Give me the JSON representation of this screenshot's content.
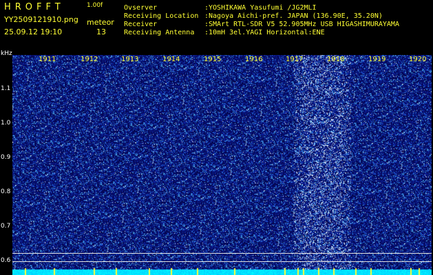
{
  "header": {
    "logo": "HROFFT",
    "version": "1.00f",
    "filename": "YY2509121910.png",
    "mode": "meteor",
    "datetime": "25.09.12 19:10",
    "count": "13"
  },
  "info": [
    {
      "label": "Ovserver",
      "value": ":YOSHIKAWA Yasufumi /JG2MLI"
    },
    {
      "label": "Receiving Location",
      "value": ":Nagoya Aichi-pref. JAPAN (136.90E, 35.20N)"
    },
    {
      "label": "Receiver",
      "value": ":SMArt RTL-SDR V5 52.905MHz USB HIGASHIMURAYAMA"
    },
    {
      "label": "Receiving Antenna",
      "value": ":10mH 3el.YAGI Horizontal:ENE"
    }
  ],
  "axis": {
    "y_unit": "kHz",
    "y_ticks": [
      "1.1",
      "1.0",
      "0.9",
      "0.8",
      "0.7",
      "0.6"
    ],
    "x_ticks": [
      "1911",
      "1912",
      "1913",
      "1914",
      "1915",
      "1916",
      "1917",
      "1918",
      "1919",
      "1920"
    ]
  },
  "colors": {
    "background": "#000000",
    "label_text": "#ffff33",
    "spectrogram_base": "#0a0a6e"
  }
}
